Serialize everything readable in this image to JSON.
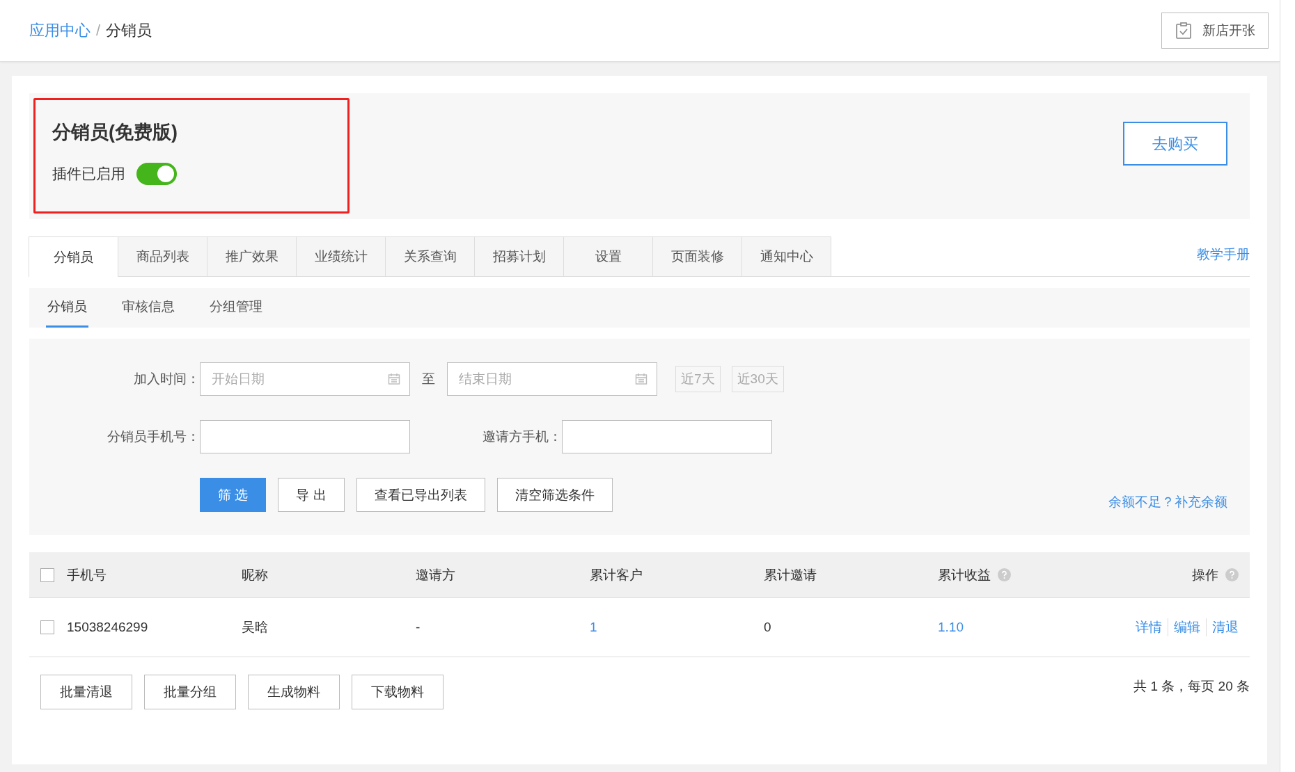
{
  "breadcrumb": {
    "items": [
      {
        "label": "应用中心",
        "link": true
      },
      {
        "label": "分销员",
        "link": false
      }
    ],
    "separator": "/"
  },
  "header_button": "新店开张",
  "plugin": {
    "title": "分销员(免费版)",
    "status_label": "插件已启用",
    "enabled": true,
    "buy_button": "去购买"
  },
  "tabs": [
    {
      "label": "分销员",
      "selected": true
    },
    {
      "label": "商品列表",
      "selected": false
    },
    {
      "label": "推广效果",
      "selected": false
    },
    {
      "label": "业绩统计",
      "selected": false
    },
    {
      "label": "关系查询",
      "selected": false
    },
    {
      "label": "招募计划",
      "selected": false
    },
    {
      "label": "设置",
      "selected": false
    },
    {
      "label": "页面装修",
      "selected": false
    },
    {
      "label": "通知中心",
      "selected": false
    }
  ],
  "tutorial_link": "教学手册",
  "subtabs": [
    {
      "label": "分销员",
      "selected": true
    },
    {
      "label": "审核信息",
      "selected": false
    },
    {
      "label": "分组管理",
      "selected": false
    }
  ],
  "filters": {
    "join_time_label": "加入时间：",
    "start_placeholder": "开始日期",
    "range_separator": "至",
    "end_placeholder": "结束日期",
    "quick_ranges": [
      "近7天",
      "近30天"
    ],
    "phone_label": "分销员手机号：",
    "inviter_phone_label": "邀请方手机：",
    "buttons": [
      {
        "label": "筛 选",
        "kind": "primary"
      },
      {
        "label": "导 出",
        "kind": "default"
      },
      {
        "label": "查看已导出列表",
        "kind": "default"
      },
      {
        "label": "清空筛选条件",
        "kind": "default"
      }
    ],
    "recharge_link": "余额不足？补充余额"
  },
  "table": {
    "select_all_checked": false,
    "columns": [
      {
        "label": "手机号",
        "help": false
      },
      {
        "label": "昵称",
        "help": false
      },
      {
        "label": "邀请方",
        "help": false
      },
      {
        "label": "累计客户",
        "help": false
      },
      {
        "label": "累计邀请",
        "help": false
      },
      {
        "label": "累计收益",
        "help": true
      },
      {
        "label": "操作",
        "help": true
      }
    ],
    "rows": [
      {
        "checked": false,
        "cells": [
          {
            "text": "15038246299",
            "kind": "text"
          },
          {
            "text": "吴晗",
            "kind": "text"
          },
          {
            "text": "-",
            "kind": "text"
          },
          {
            "text": "1",
            "kind": "link"
          },
          {
            "text": "0",
            "kind": "text"
          },
          {
            "text": "1.10",
            "kind": "link"
          }
        ],
        "actions": [
          "详情",
          "编辑",
          "清退"
        ]
      }
    ]
  },
  "footer_buttons": [
    "批量清退",
    "批量分组",
    "生成物料",
    "下载物料"
  ],
  "pagination": "共 1 条，每页 20 条"
}
